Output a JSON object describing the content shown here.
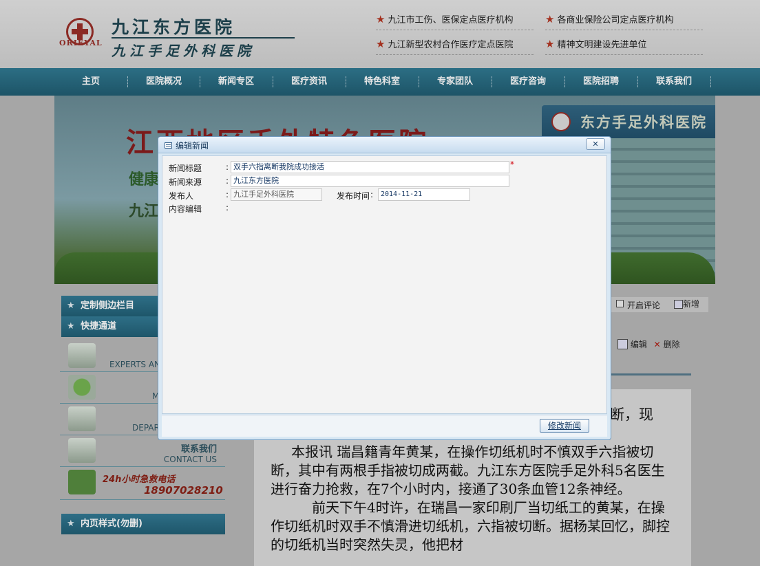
{
  "header": {
    "logo_en": "ORIEYAL",
    "logo_cn1": "九江东方医院",
    "logo_cn2": "九江手足外科医院",
    "certs": [
      "九江市工伤、医保定点医疗机构",
      "各商业保险公司定点医疗机构",
      "九江新型农村合作医疗定点医院",
      "精神文明建设先进单位"
    ]
  },
  "nav": {
    "items": [
      "主页",
      "医院概况",
      "新闻专区",
      "医疗资讯",
      "特色科室",
      "专家团队",
      "医疗咨询",
      "医院招聘",
      "联系我们"
    ]
  },
  "banner": {
    "headline": "江西地区手外特色医院",
    "line2": "健康",
    "line3": "九江",
    "sign": "东方手足外科医院"
  },
  "sidebar": {
    "head1": "定制侧边栏目",
    "head2": "快捷通道",
    "items": [
      {
        "text": "EXPERTS AN",
        "icon": "doctor-icon"
      },
      {
        "text": "M",
        "icon": "globe-icon"
      },
      {
        "text": "DEPAR",
        "icon": "chart-icon"
      },
      {
        "text_cn": "联系我们",
        "text_en": "CONTACT US",
        "icon": "mail-icon"
      }
    ],
    "emergency": {
      "label": "24h小时急救电话",
      "phone": "18907028210",
      "icon": "phone-icon"
    },
    "head3": "内页样式(勿删)"
  },
  "right_tools": {
    "comment_label": "开启评论",
    "add_label": "新增",
    "edit_label": "编辑",
    "delete_label": "删除"
  },
  "article": {
    "fragment": "断，现",
    "paragraphs": [
      "本报讯 瑞昌籍青年黄某，在操作切纸机时不慎双手六指被切断，其中有两根手指被切成两截。九江东方医院手足外科5名医生进行奋力抢救，在7个小时内，接通了30条血管12条神经。",
      "前天下午4时许，在瑞昌一家印刷厂当切纸工的黄某，在操作切纸机时双手不慎滑进切纸机，六指被切断。据杨某回忆，脚控的切纸机当时突然失灵，他把材"
    ]
  },
  "modal": {
    "title": "编辑新闻",
    "close_label": "✕",
    "fields": {
      "title_label": "新闻标题",
      "title_value": "双手六指离断我院成功接活",
      "source_label": "新闻来源",
      "source_value": "九江东方医院",
      "author_label": "发布人",
      "author_value": "九江手足外科医院",
      "date_label": "发布时间",
      "date_value": "2014-11-21",
      "content_label": "内容编辑"
    },
    "colon": ":",
    "required_mark": "*",
    "submit_label": "修改新闻"
  },
  "colors": {
    "nav_bg": "#1d5467",
    "accent_red": "#a3301e",
    "modal_border": "#6f98bd"
  }
}
